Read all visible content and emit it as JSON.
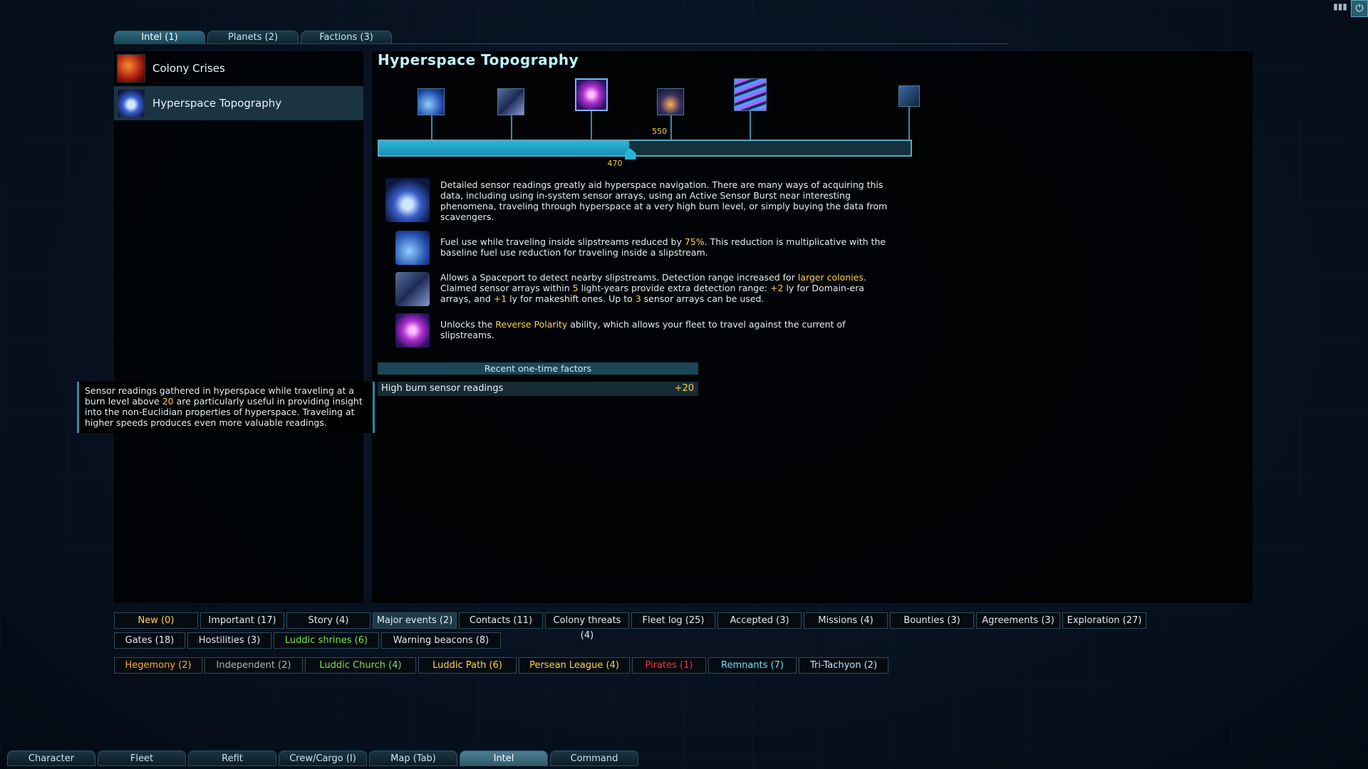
{
  "top_tabs": [
    {
      "label": "Intel (1)",
      "active": true
    },
    {
      "label": "Planets (2)",
      "active": false
    },
    {
      "label": "Factions (3)",
      "active": false
    }
  ],
  "intel_list": [
    {
      "label": "Colony Crises",
      "icon": "colony-crises-icon",
      "selected": false
    },
    {
      "label": "Hyperspace Topography",
      "icon": "hyperspace-topography-icon",
      "selected": true
    }
  ],
  "detail": {
    "title": "Hyperspace Topography",
    "progress": {
      "current": 470,
      "next_milestone": 550,
      "fraction": 0.47,
      "current_label": "470",
      "next_label": "550"
    },
    "paragraphs": [
      {
        "text_parts": [
          "Detailed sensor readings greatly aid hyperspace navigation. There are many ways of acquiring this data, including using in-system sensor arrays, using an Active Sensor Burst near interesting phenomena, traveling through hyperspace at a very high burn level, or simply buying the data from scavengers."
        ]
      },
      {
        "text_parts": [
          "Fuel use while traveling inside slipstreams reduced by ",
          "75%",
          ". This reduction is multiplicative with the baseline fuel use reduction for traveling inside a slipstream."
        ]
      },
      {
        "text_parts": [
          "Allows a Spaceport to detect nearby slipstreams. Detection range increased for ",
          "larger colonies",
          ". Claimed sensor arrays within ",
          "5",
          " light-years provide extra detection range: ",
          "+2",
          " ly for Domain-era arrays, and ",
          "+1",
          " ly for makeshift ones. Up to ",
          "3",
          " sensor arrays can be used."
        ]
      },
      {
        "text_parts": [
          "Unlocks the ",
          "Reverse Polarity",
          " ability, which allows your fleet to travel against the current of slipstreams."
        ]
      }
    ],
    "factors_header": "Recent one-time factors",
    "factors": [
      {
        "label": "High burn sensor readings",
        "value": "+20"
      }
    ]
  },
  "tooltip": {
    "text_parts": [
      "Sensor readings gathered in hyperspace while traveling at a burn level above ",
      "20",
      " are particularly useful in providing insight into the non-Euclidian properties of hyperspace. Traveling at higher speeds produces even more valuable readings."
    ]
  },
  "filter_rows": [
    [
      {
        "label": "New (0)",
        "color": "yellow",
        "selected": false
      },
      {
        "label": "Important (17)",
        "color": "",
        "selected": false
      },
      {
        "label": "Story (4)",
        "color": "",
        "selected": false
      },
      {
        "label": "Major events (2)",
        "color": "",
        "selected": true
      },
      {
        "label": "Contacts (11)",
        "color": "",
        "selected": false
      },
      {
        "label": "Colony threats (4)",
        "color": "",
        "selected": false
      },
      {
        "label": "Fleet log (25)",
        "color": "",
        "selected": false
      },
      {
        "label": "Accepted (3)",
        "color": "",
        "selected": false
      },
      {
        "label": "Missions (4)",
        "color": "",
        "selected": false
      },
      {
        "label": "Bounties (3)",
        "color": "",
        "selected": false
      },
      {
        "label": "Agreements (3)",
        "color": "",
        "selected": false
      },
      {
        "label": "Exploration (27)",
        "color": "",
        "selected": false
      }
    ],
    [
      {
        "label": "Gates (18)",
        "color": "",
        "selected": false
      },
      {
        "label": "Hostilities (3)",
        "color": "",
        "selected": false
      },
      {
        "label": "Luddic shrines (6)",
        "color": "green",
        "selected": false
      },
      {
        "label": "Warning beacons (8)",
        "color": "",
        "selected": false
      }
    ],
    [
      {
        "label": "Hegemony (2)",
        "color": "orange",
        "selected": false
      },
      {
        "label": "Independent (2)",
        "color": "grey",
        "selected": false
      },
      {
        "label": "Luddic Church (4)",
        "color": "green",
        "selected": false
      },
      {
        "label": "Luddic Path (6)",
        "color": "yellow",
        "selected": false
      },
      {
        "label": "Persean League (4)",
        "color": "yellow",
        "selected": false
      },
      {
        "label": "Pirates (1)",
        "color": "red",
        "selected": false
      },
      {
        "label": "Remnants (7)",
        "color": "cyan",
        "selected": false
      },
      {
        "label": "Tri-Tachyon (2)",
        "color": "lightblue",
        "selected": false
      }
    ]
  ],
  "bottom_tabs": [
    {
      "label": "Character",
      "active": false
    },
    {
      "label": "Fleet",
      "active": false
    },
    {
      "label": "Refit",
      "active": false
    },
    {
      "label": "Crew/Cargo (I)",
      "active": false
    },
    {
      "label": "Map (Tab)",
      "active": false
    },
    {
      "label": "Intel",
      "active": true
    },
    {
      "label": "Command",
      "active": false
    }
  ],
  "colors": {
    "accent": "#2ab4d8",
    "highlight": "#ffd24a",
    "panel": "#000000"
  }
}
